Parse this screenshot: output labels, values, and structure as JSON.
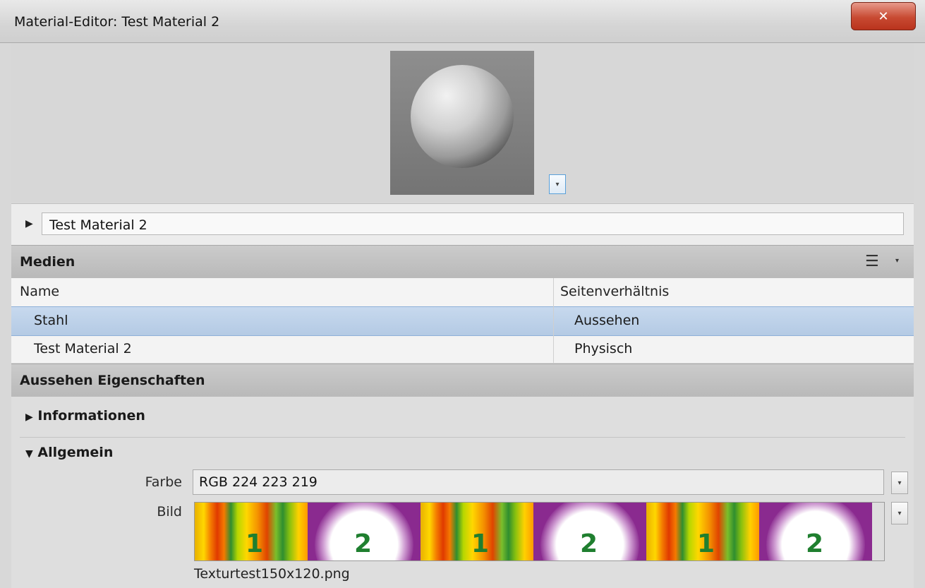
{
  "window": {
    "title": "Material-Editor: Test Material 2",
    "close_icon": "✕"
  },
  "preview": {
    "dropdown_icon": "▾"
  },
  "name_row": {
    "expand_icon": "▶",
    "value": "Test Material 2"
  },
  "media_section": {
    "title": "Medien",
    "list_icon": "☰",
    "list_dropdown_icon": "▾"
  },
  "table": {
    "columns": [
      "Name",
      "Seitenverhältnis"
    ],
    "rows": [
      {
        "name": "Stahl",
        "ratio": "Aussehen",
        "selected": true
      },
      {
        "name": "Test Material 2",
        "ratio": "Physisch",
        "selected": false
      }
    ]
  },
  "appearance_section": {
    "title": "Aussehen Eigenschaften"
  },
  "groups": {
    "info": {
      "arrow": "▶",
      "label": "Informationen"
    },
    "general": {
      "arrow": "▼",
      "label": "Allgemein"
    }
  },
  "properties": {
    "color_label": "Farbe",
    "color_value": "RGB 224 223 219",
    "image_label": "Bild",
    "image_filename": "Texturtest150x120.png",
    "texture_numbers": [
      "1",
      "2",
      "1",
      "2",
      "1",
      "2"
    ]
  },
  "colors": {
    "selection": "#b4cae4",
    "close": "#c84a32",
    "texture_purple": "#8a2a8f"
  }
}
